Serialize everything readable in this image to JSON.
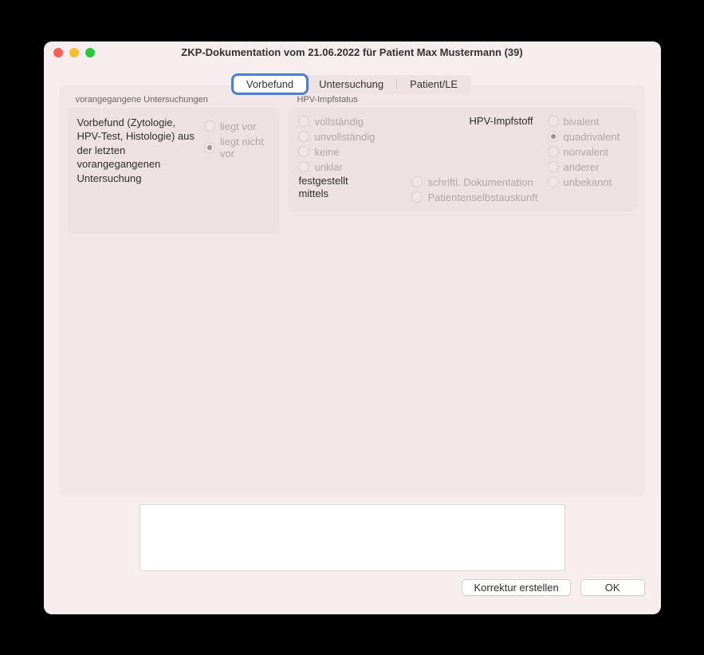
{
  "window": {
    "title": "ZKP-Dokumentation vom 21.06.2022 für Patient Max Mustermann (39)"
  },
  "tabs": {
    "vorbefund": "Vorbefund",
    "untersuchung": "Untersuchung",
    "patient_le": "Patient/LE"
  },
  "prev": {
    "section_label": "vorangegangene Untersuchungen",
    "desc": "Vorbefund (Zytologie, HPV-Test, Histologie) aus der letzten vorangegangenen Untersuchung",
    "liegt_vor": "liegt vor",
    "liegt_nicht_vor": "liegt nicht vor"
  },
  "hpv": {
    "section_label": "HPV-Impfstatus",
    "vollstaendig": "vollständig",
    "unvollstaendig": "unvollständig",
    "keine": "keine",
    "unklar": "unklar",
    "festgestellt_label": "festgestellt mittels",
    "schriftl": "schriftl. Dokumentation",
    "patient": "Patientenselbstauskunft",
    "impfstoff_heading": "HPV-Impfstoff",
    "bivalent": "bivalent",
    "quadrivalent": "quadrivalent",
    "nonvalent": "nonvalent",
    "anderer": "anderer",
    "unbekannt": "unbekannt"
  },
  "footer": {
    "korrektur": "Korrektur erstellen",
    "ok": "OK"
  }
}
